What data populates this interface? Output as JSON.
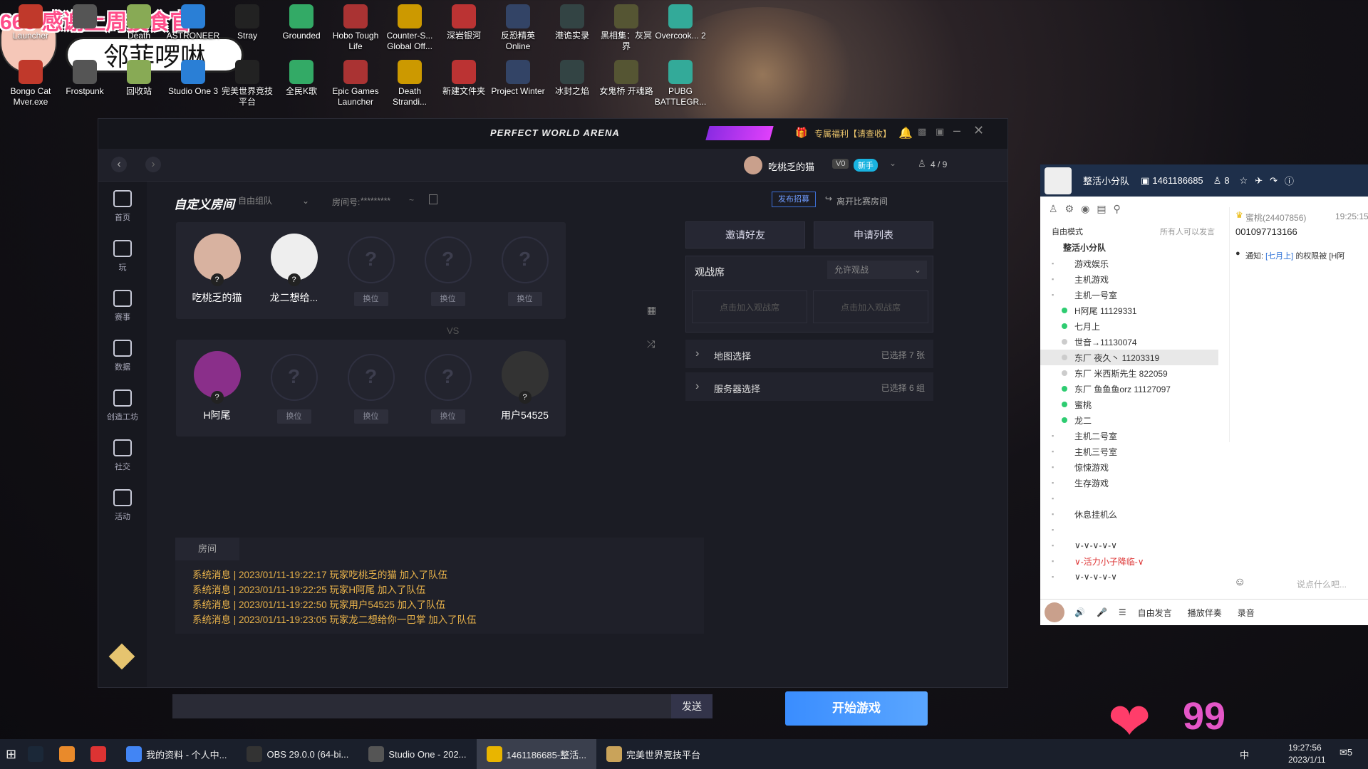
{
  "overlay": {
    "banner": "666 感谢上周投食官",
    "name_plate": "邻菲啰啉",
    "likes": "99"
  },
  "desktop": {
    "icons_row1": [
      "Launcher",
      "",
      "Death",
      "ASTRONEER",
      "Stray",
      "Grounded",
      "Hobo Tough Life",
      "Counter-S... Global Off...",
      "深岩银河",
      "反恐精英 Online",
      "港诡实录",
      "黑相集：灰冥界",
      "Overcook... 2"
    ],
    "icons_row2": [
      "Bongo Cat Mver.exe",
      "Frostpunk",
      "回收站",
      "Studio One 3",
      "完美世界竞技平台",
      "全民K歌",
      "Epic Games Launcher",
      "Death Strandi...",
      "新建文件夹",
      "Project Winter",
      "冰封之焰",
      "女鬼桥 开魂路",
      "PUBG BATTLEGR..."
    ]
  },
  "arena": {
    "title": "PERFECT WORLD ARENA",
    "promo": "专属福利【请查收】",
    "user": {
      "name": "吃桃乏的猫",
      "level": "V0",
      "badge": "新手"
    },
    "party_count": "4 / 9",
    "sidebar": [
      {
        "label": "首页",
        "icon": "home-icon"
      },
      {
        "label": "玩",
        "icon": "play-icon"
      },
      {
        "label": "赛事",
        "icon": "trophy-icon"
      },
      {
        "label": "数据",
        "icon": "chart-icon"
      },
      {
        "label": "创造工坊",
        "icon": "workshop-icon"
      },
      {
        "label": "社交",
        "icon": "social-icon"
      },
      {
        "label": "活动",
        "icon": "gift-icon"
      }
    ],
    "room": {
      "title": "自定义房间",
      "mode": "自由组队",
      "room_no_label": "房间号:",
      "room_no": "*********",
      "publish": "发布招募",
      "leave": "离开比赛房间",
      "vs": "VS",
      "swap": "换位",
      "team_a": [
        {
          "name": "吃桃乏的猫",
          "filled": true
        },
        {
          "name": "龙二想给...",
          "filled": true
        },
        {
          "name": "",
          "filled": false
        },
        {
          "name": "",
          "filled": false
        },
        {
          "name": "",
          "filled": false
        }
      ],
      "team_b": [
        {
          "name": "H阿尾",
          "filled": true
        },
        {
          "name": "",
          "filled": false
        },
        {
          "name": "",
          "filled": false
        },
        {
          "name": "",
          "filled": false
        },
        {
          "name": "用户54525",
          "filled": true
        }
      ],
      "invite": "邀请好友",
      "applies": "申请列表",
      "spectator": "观战席",
      "spectator_opt": "允许观战",
      "join_spec": "点击加入观战席",
      "map_label": "地图选择",
      "map_value": "已选择 7 张",
      "server_label": "服务器选择",
      "server_value": "已选择 6 组",
      "chat_tab": "房间",
      "messages": [
        "系统消息 | 2023/01/11-19:22:17 玩家吃桃乏的猫 加入了队伍",
        "系统消息 | 2023/01/11-19:22:25 玩家H阿尾 加入了队伍",
        "系统消息 | 2023/01/11-19:22:50 玩家用户54525 加入了队伍",
        "系统消息 | 2023/01/11-19:23:05 玩家龙二想给你一巴掌 加入了队伍"
      ],
      "send": "发送",
      "start": "开始游戏"
    }
  },
  "qq": {
    "team": "整活小分队",
    "id": "1461186685",
    "members": "8",
    "mode": "自由模式",
    "mode_hint": "所有人可以发言",
    "channel_root": "整活小分队",
    "tree": [
      "游戏娱乐",
      "主机游戏",
      "主机一号室",
      "H阿尾 11129331",
      "七月上",
      "世音→11130074",
      "东厂 夜久丶 11203319",
      "东厂 米西斯先生 822059",
      "东厂 鱼鱼鱼orz 11127097",
      "蜜桃",
      "龙二",
      "主机二号室",
      "主机三号室",
      "惊悚游戏",
      "生存游戏",
      "",
      "休息挂机么",
      "",
      "∨-∨-∨-∨-∨",
      "∨-活力小子降临-∨",
      "∨-∨-∨-∨-∨"
    ],
    "chat": {
      "user": "蜜桃(24407856)",
      "time": "19:25:15",
      "text": "001097713166",
      "notice_prefix": "通知:",
      "notice_user": "[七月上]",
      "notice_text": "的权限被 [H阿"
    },
    "input_placeholder": "说点什么吧...",
    "bottom": [
      "自由发言",
      "播放伴奏",
      "录音"
    ]
  },
  "taskbar": {
    "items": [
      "我的资料 - 个人中...",
      "OBS 29.0.0 (64-bi...",
      "Studio One - 202...",
      "1461186685-整活...",
      "完美世界竞技平台"
    ],
    "time": "19:27:56",
    "date": "2023/1/11",
    "ime": "中",
    "notif": "5"
  }
}
